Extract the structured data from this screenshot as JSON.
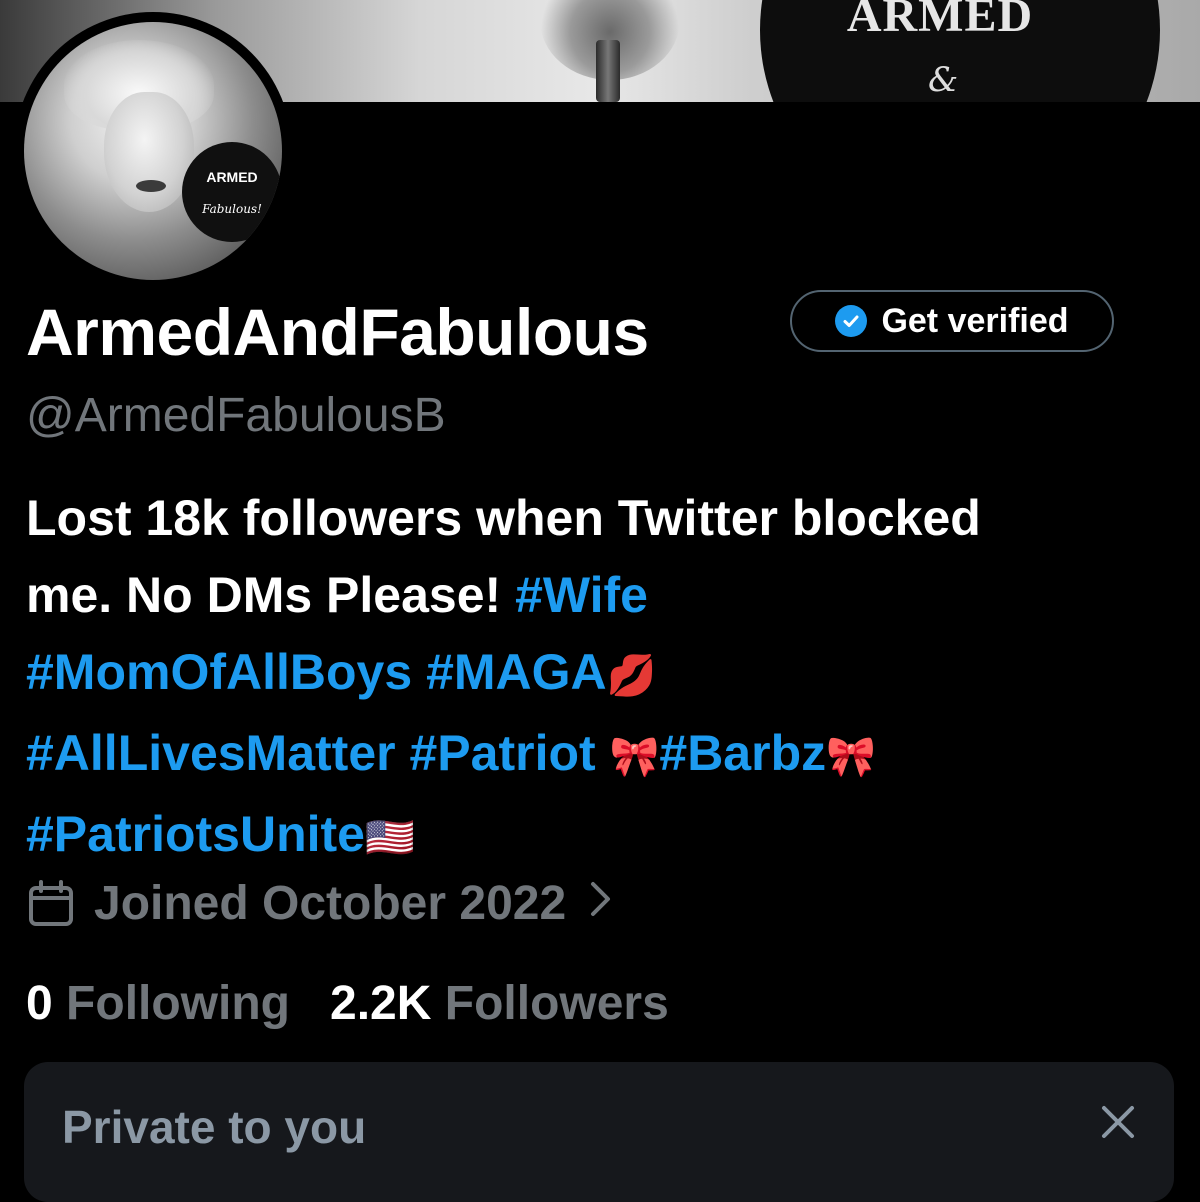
{
  "banner": {
    "logo_text": "ARMED",
    "logo_amp": "&"
  },
  "avatar": {
    "badge_title": "ARMED",
    "badge_sub": "Fabulous!"
  },
  "profile": {
    "display_name": "ArmedAndFabulous",
    "handle": "@ArmedFabulousB",
    "get_verified_label": "Get verified",
    "bio": {
      "line1": "Lost 18k followers when Twitter blocked",
      "line2_text": "me. No DMs Please! ",
      "tag_wife": "#Wife",
      "tag_momofallboys": "#MomOfAllBoys",
      "tag_maga": "#MAGA",
      "emoji_kiss": "💋",
      "tag_alllivesmatter": "#AllLivesMatter",
      "tag_patriot": "#Patriot",
      "emoji_ribbon1": "🎀",
      "tag_barbz": "#Barbz",
      "emoji_ribbon2": "🎀",
      "tag_patriotsunite": "#PatriotsUnite",
      "emoji_flag": "🇺🇸"
    },
    "joined": "Joined October 2022",
    "following_count": "0",
    "following_label": "Following",
    "followers_count": "2.2K",
    "followers_label": "Followers"
  },
  "private_card": {
    "title": "Private to you"
  },
  "colors": {
    "accent": "#1d9bf0",
    "muted": "#71767b",
    "card_bg": "#16181c"
  },
  "icons": [
    "calendar-icon",
    "chevron-right-icon",
    "verified-check-icon",
    "close-icon"
  ]
}
